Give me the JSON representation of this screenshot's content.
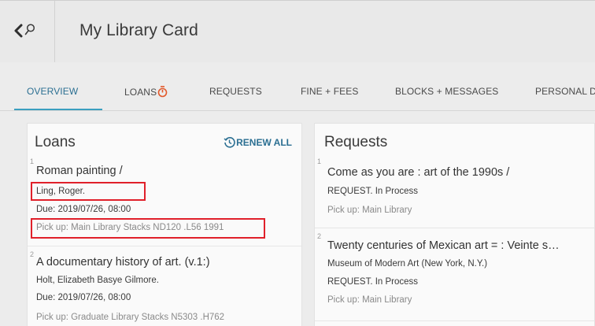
{
  "header": {
    "title": "My Library Card",
    "back_icon": "chevron-left-icon",
    "search_icon": "search-icon"
  },
  "tabs": [
    {
      "label": "OVERVIEW",
      "active": true
    },
    {
      "label": "LOANS",
      "icon": "timer-icon"
    },
    {
      "label": "REQUESTS"
    },
    {
      "label": "FINE + FEES"
    },
    {
      "label": "BLOCKS + MESSAGES"
    },
    {
      "label": "PERSONAL D"
    }
  ],
  "colors": {
    "accent": "#2b6f92",
    "underline": "#3b9fbf",
    "timer": "#e2582a",
    "highlight": "#e0202a"
  },
  "loans": {
    "title": "Loans",
    "renew_all_label": "RENEW ALL",
    "items": [
      {
        "index": "1",
        "title": "Roman painting /",
        "author": "Ling, Roger.",
        "due": "Due: 2019/07/26, 08:00",
        "pickup": "Pick up: Main Library Stacks ND120 .L56 1991"
      },
      {
        "index": "2",
        "title": "A documentary history of art. (v.1:)",
        "author": "Holt, Elizabeth Basye Gilmore.",
        "due": "Due: 2019/07/26, 08:00",
        "pickup": "Pick up: Graduate Library Stacks N5303 .H762"
      }
    ]
  },
  "requests": {
    "title": "Requests",
    "items": [
      {
        "index": "1",
        "title": "Come as you are : art of the 1990s /",
        "status": "REQUEST. In Process",
        "pickup": "Pick up: Main Library"
      },
      {
        "index": "2",
        "title": "Twenty centuries of Mexican art = : Veinte s…",
        "author": "Museum of Modern Art (New York, N.Y.)",
        "status": "REQUEST. In Process",
        "pickup": "Pick up: Main Library"
      }
    ]
  }
}
